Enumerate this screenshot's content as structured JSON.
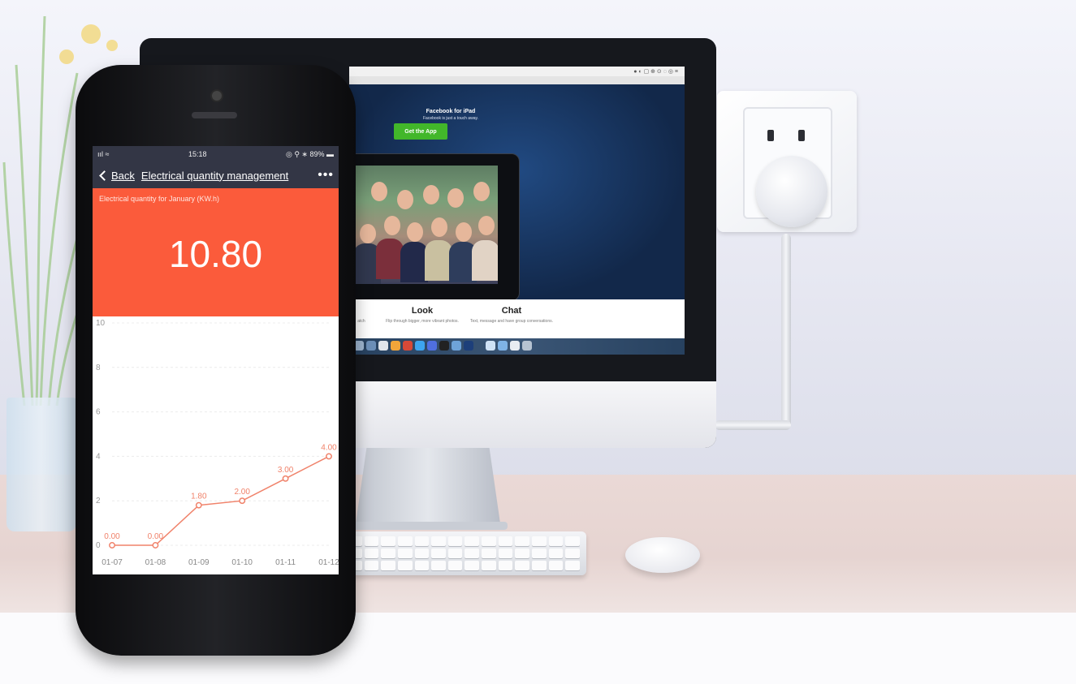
{
  "phone": {
    "status_bar": {
      "signal": "ııl ≈",
      "time": "15:18",
      "battery": "◎ ⚲ ∗ 89% ▬"
    },
    "nav": {
      "back_label": "Back",
      "title": "Electrical quantity management",
      "more_label": "•••"
    },
    "summary": {
      "label": "Electrical quantity for January (KW.h)",
      "value": "10.80"
    },
    "colors": {
      "accent": "#fb5b3b",
      "navbar": "#333645",
      "line": "#f0826a"
    }
  },
  "chart_data": {
    "type": "line",
    "categories": [
      "01-07",
      "01-08",
      "01-09",
      "01-10",
      "01-11",
      "01-12"
    ],
    "series": [
      {
        "values": [
          0.0,
          0.0,
          1.8,
          2.0,
          3.0,
          4.0
        ]
      }
    ],
    "data_labels": [
      "0.00",
      "0.00",
      "1.80",
      "2.00",
      "3.00",
      "4.00"
    ],
    "yticks": [
      0,
      2,
      4,
      6,
      8,
      10
    ],
    "ylim": [
      0,
      10
    ],
    "grid": true
  },
  "monitor": {
    "banner_title": "Facebook for iPad",
    "banner_sub": "Facebook is just a touch away.",
    "cta_label": "Get the App",
    "features": [
      {
        "title": "",
        "sub": "atch"
      },
      {
        "title": "Look",
        "sub": "Flip through bigger, more vibrant photos."
      },
      {
        "title": "Chat",
        "sub": "Text, message and have group conversations."
      }
    ]
  }
}
